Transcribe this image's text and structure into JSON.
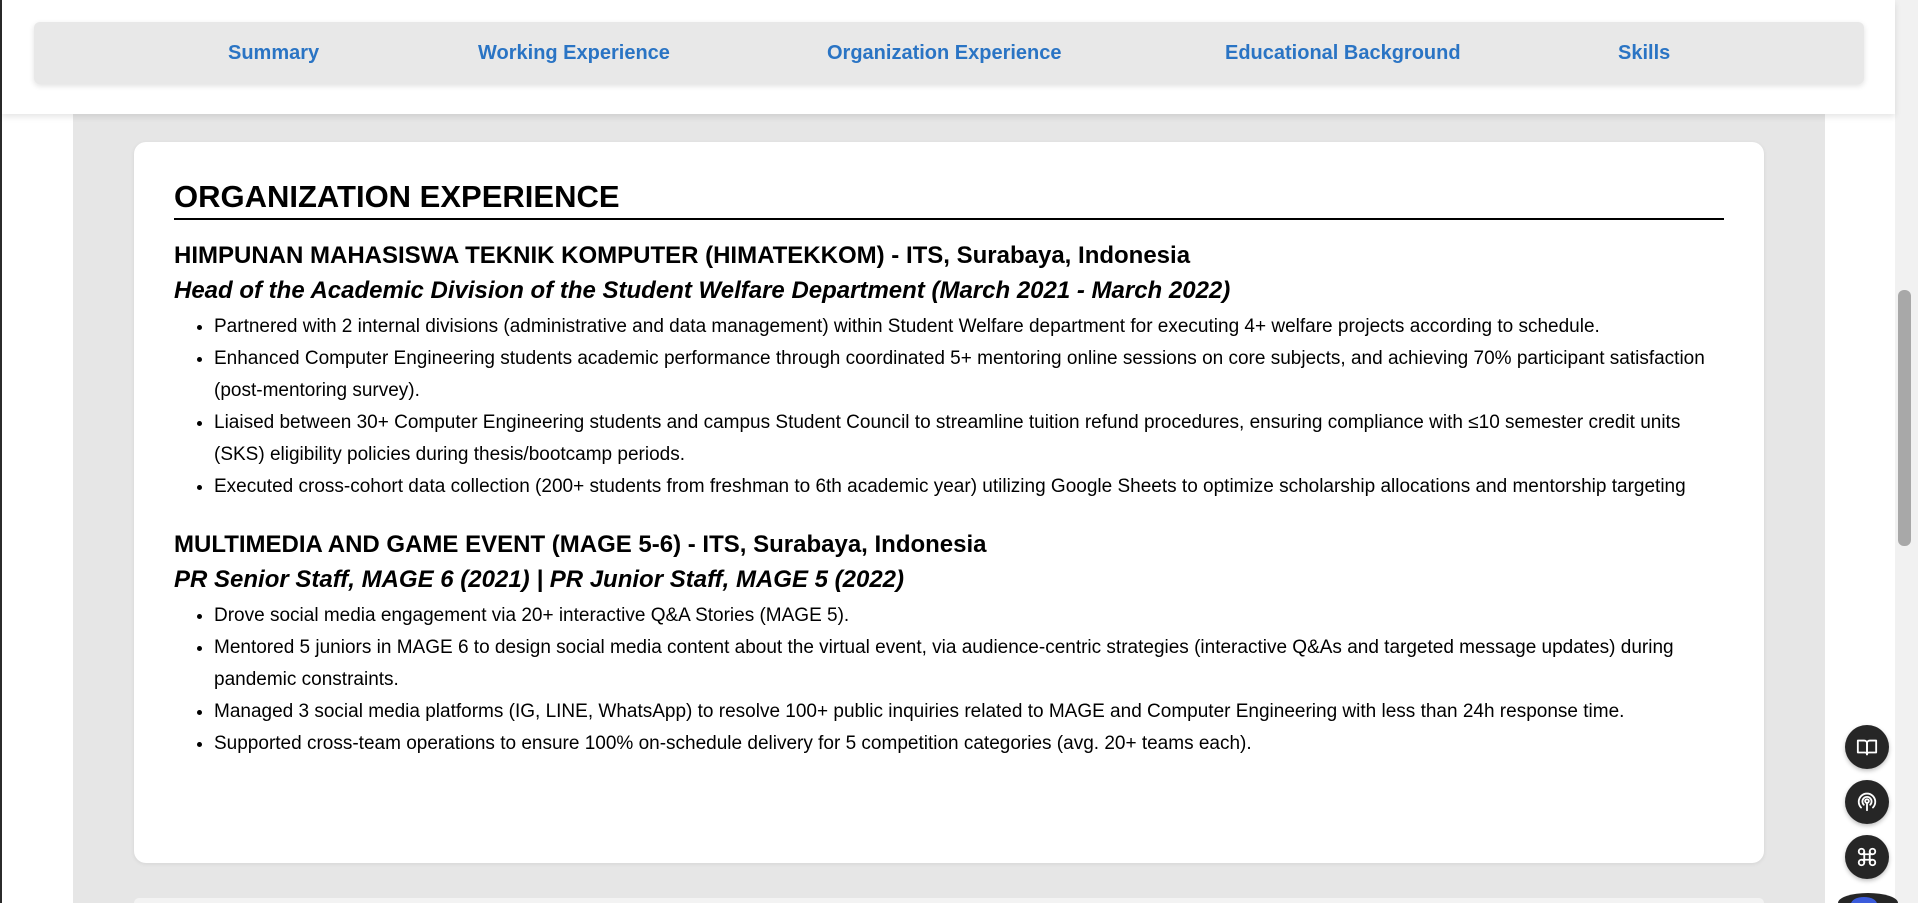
{
  "nav": {
    "items": [
      {
        "label": "Summary"
      },
      {
        "label": "Working Experience"
      },
      {
        "label": "Organization Experience"
      },
      {
        "label": "Educational Background"
      },
      {
        "label": "Skills"
      }
    ]
  },
  "section": {
    "title": "ORGANIZATION EXPERIENCE",
    "orgs": [
      {
        "name": "HIMPUNAN MAHASISWA TEKNIK KOMPUTER (HIMATEKKOM) - ITS, Surabaya, Indonesia",
        "role": "Head of the Academic Division of the Student Welfare Department (March 2021 - March 2022)",
        "bullets": [
          "Partnered with 2 internal divisions (administrative and data management) within Student Welfare department for executing 4+ welfare projects according to schedule.",
          "Enhanced Computer Engineering students academic performance through coordinated 5+ mentoring online sessions on core subjects, and achieving 70% participant satisfaction (post-mentoring survey).",
          "Liaised between 30+ Computer Engineering students and campus Student Council to streamline tuition refund procedures, ensuring compliance with ≤10 semester credit units (SKS) eligibility policies during thesis/bootcamp periods.",
          "Executed cross-cohort data collection (200+ students from freshman to 6th academic year) utilizing Google Sheets to optimize scholarship allocations and mentorship targeting"
        ]
      },
      {
        "name": "MULTIMEDIA AND GAME EVENT (MAGE 5-6) - ITS, Surabaya, Indonesia",
        "role": "PR Senior Staff, MAGE 6 (2021) | PR Junior Staff, MAGE 5 (2022)",
        "bullets": [
          "Drove social media engagement via 20+ interactive Q&A Stories (MAGE 5).",
          "Mentored 5 juniors in MAGE 6 to design social media content about the virtual event, via audience-centric strategies (interactive Q&As and targeted message updates) during pandemic constraints.",
          "Managed 3 social media platforms (IG, LINE, WhatsApp) to resolve 100+ public inquiries related to MAGE and Computer Engineering with less than 24h response time.",
          "Supported cross-team operations to ensure 100% on-schedule delivery for 5 competition categories (avg. 20+ teams each)."
        ]
      }
    ]
  },
  "widgets": [
    {
      "icon": "book-icon"
    },
    {
      "icon": "podcast-icon"
    },
    {
      "icon": "command-icon"
    }
  ],
  "colors": {
    "nav_link": "#2a74c4",
    "page_bg": "#e6e6e6",
    "card_bg": "#ffffff",
    "fab_bg": "#262626"
  }
}
